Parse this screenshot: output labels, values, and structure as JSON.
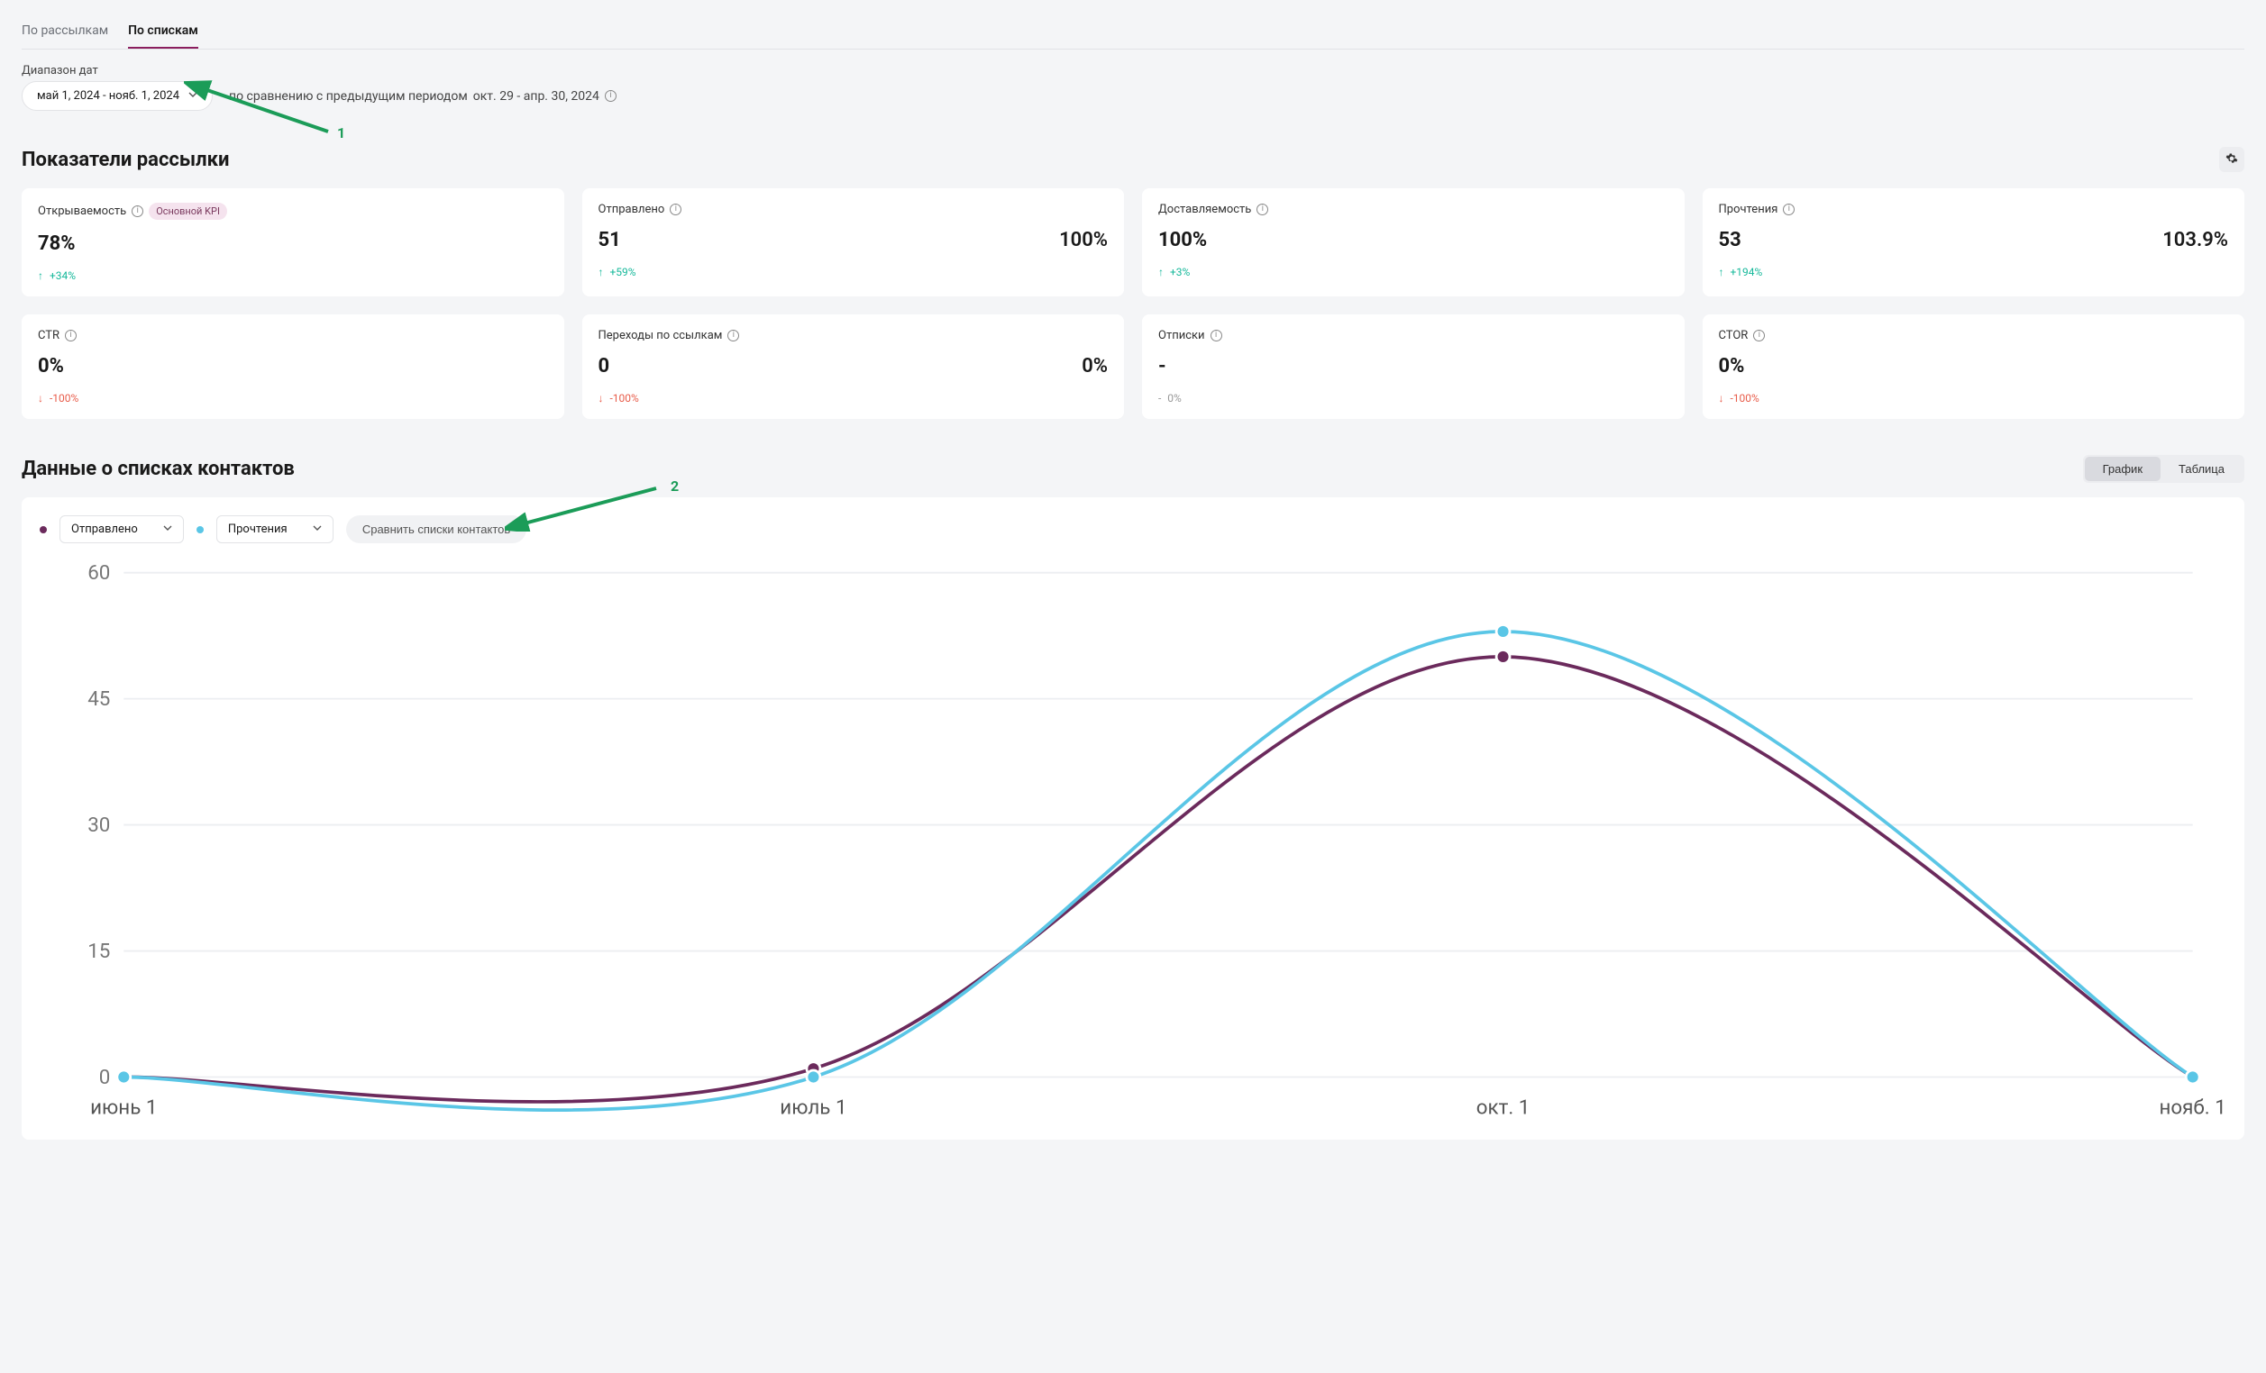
{
  "tabs": {
    "by_campaigns": "По рассылкам",
    "by_lists": "По спискам"
  },
  "date_range": {
    "label": "Диапазон дат",
    "value": "май 1, 2024 - нояб. 1, 2024",
    "compare_prefix": "по сравнению с предыдущим периодом",
    "compare_range": "окт. 29 - апр. 30, 2024"
  },
  "kpi_section_title": "Показатели рассылки",
  "kpi_badge": "Основной KPI",
  "kpi_cards": [
    {
      "title": "Открываемость",
      "value": "78%",
      "sub": "",
      "change": "+34%",
      "dir": "up",
      "badge": true
    },
    {
      "title": "Отправлено",
      "value": "51",
      "sub": "100%",
      "change": "+59%",
      "dir": "up",
      "badge": false
    },
    {
      "title": "Доставляемость",
      "value": "100%",
      "sub": "",
      "change": "+3%",
      "dir": "up",
      "badge": false
    },
    {
      "title": "Прочтения",
      "value": "53",
      "sub": "103.9%",
      "change": "+194%",
      "dir": "up",
      "badge": false
    },
    {
      "title": "CTR",
      "value": "0%",
      "sub": "",
      "change": "-100%",
      "dir": "down",
      "badge": false
    },
    {
      "title": "Переходы по ссылкам",
      "value": "0",
      "sub": "0%",
      "change": "-100%",
      "dir": "down",
      "badge": false
    },
    {
      "title": "Отписки",
      "value": "-",
      "sub": "",
      "change": "0%",
      "dir": "none",
      "badge": false
    },
    {
      "title": "CTOR",
      "value": "0%",
      "sub": "",
      "change": "-100%",
      "dir": "down",
      "badge": false
    }
  ],
  "chart_section_title": "Данные о списках контактов",
  "view_toggle": {
    "chart": "График",
    "table": "Таблица"
  },
  "series_controls": {
    "series_a": "Отправлено",
    "series_b": "Прочтения",
    "compare_btn": "Сравнить списки контактов"
  },
  "annotations": {
    "one": "1",
    "two": "2"
  },
  "chart_data": {
    "type": "line",
    "x_categories": [
      "июнь 1",
      "июль 1",
      "окт. 1",
      "нояб. 1"
    ],
    "y_ticks": [
      0,
      15,
      30,
      45,
      60
    ],
    "ylim": [
      0,
      60
    ],
    "series": [
      {
        "name": "Отправлено",
        "color": "#6b2a5c",
        "values": [
          0,
          1,
          50,
          0
        ]
      },
      {
        "name": "Прочтения",
        "color": "#5ac6e6",
        "values": [
          0,
          0,
          53,
          0
        ]
      }
    ]
  }
}
